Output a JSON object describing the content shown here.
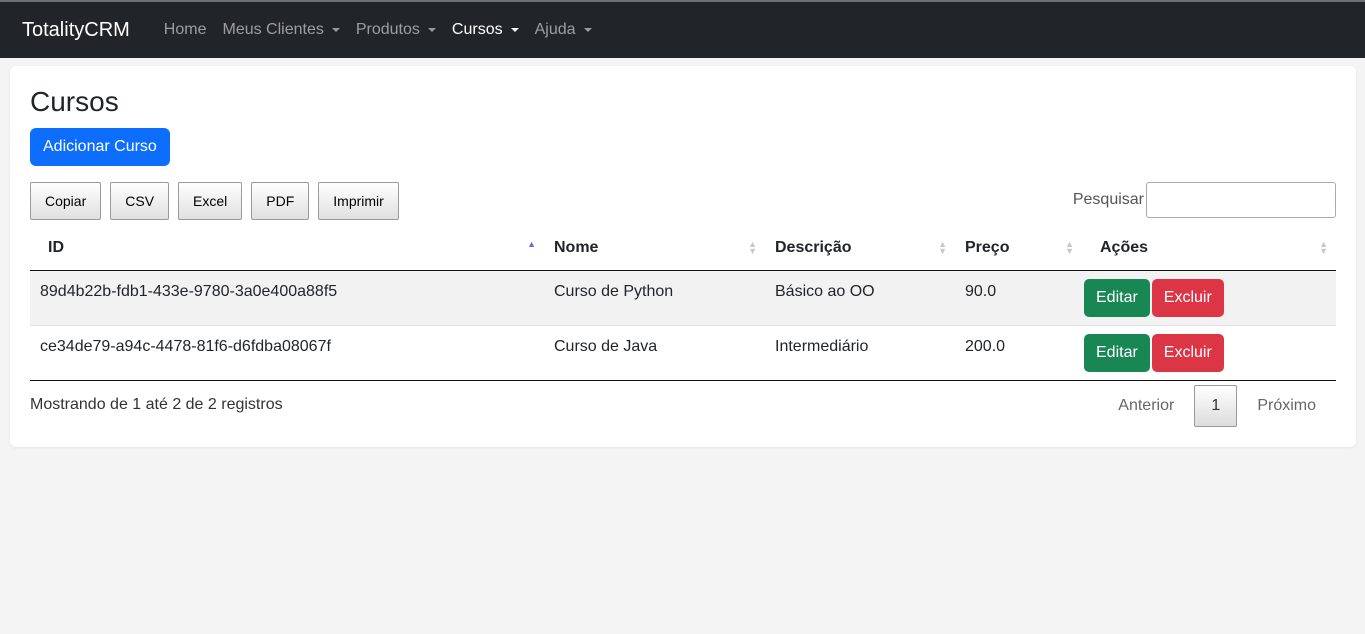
{
  "navbar": {
    "brand": "TotalityCRM",
    "items": [
      {
        "label": "Home",
        "dropdown": false,
        "active": false
      },
      {
        "label": "Meus Clientes",
        "dropdown": true,
        "active": false
      },
      {
        "label": "Produtos",
        "dropdown": true,
        "active": false
      },
      {
        "label": "Cursos",
        "dropdown": true,
        "active": true
      },
      {
        "label": "Ajuda",
        "dropdown": true,
        "active": false
      }
    ]
  },
  "page": {
    "title": "Cursos",
    "add_button": "Adicionar Curso"
  },
  "export_buttons": [
    "Copiar",
    "CSV",
    "Excel",
    "PDF",
    "Imprimir"
  ],
  "search": {
    "label": "Pesquisar",
    "value": ""
  },
  "table": {
    "columns": [
      "ID",
      "Nome",
      "Descrição",
      "Preço",
      "Ações"
    ],
    "rows": [
      {
        "id": "89d4b22b-fdb1-433e-9780-3a0e400a88f5",
        "nome": "Curso de Python",
        "descricao": "Básico ao OO",
        "preco": "90.0"
      },
      {
        "id": "ce34de79-a94c-4478-81f6-d6fdba08067f",
        "nome": "Curso de Java",
        "descricao": "Intermediário",
        "preco": "200.0"
      }
    ],
    "edit_label": "Editar",
    "delete_label": "Excluir"
  },
  "footer": {
    "info": "Mostrando de 1 até 2 de 2 registros",
    "prev": "Anterior",
    "current_page": "1",
    "next": "Próximo"
  },
  "colors": {
    "navbar_bg": "#212529",
    "primary": "#0d6efd",
    "success": "#198754",
    "danger": "#dc3545"
  }
}
